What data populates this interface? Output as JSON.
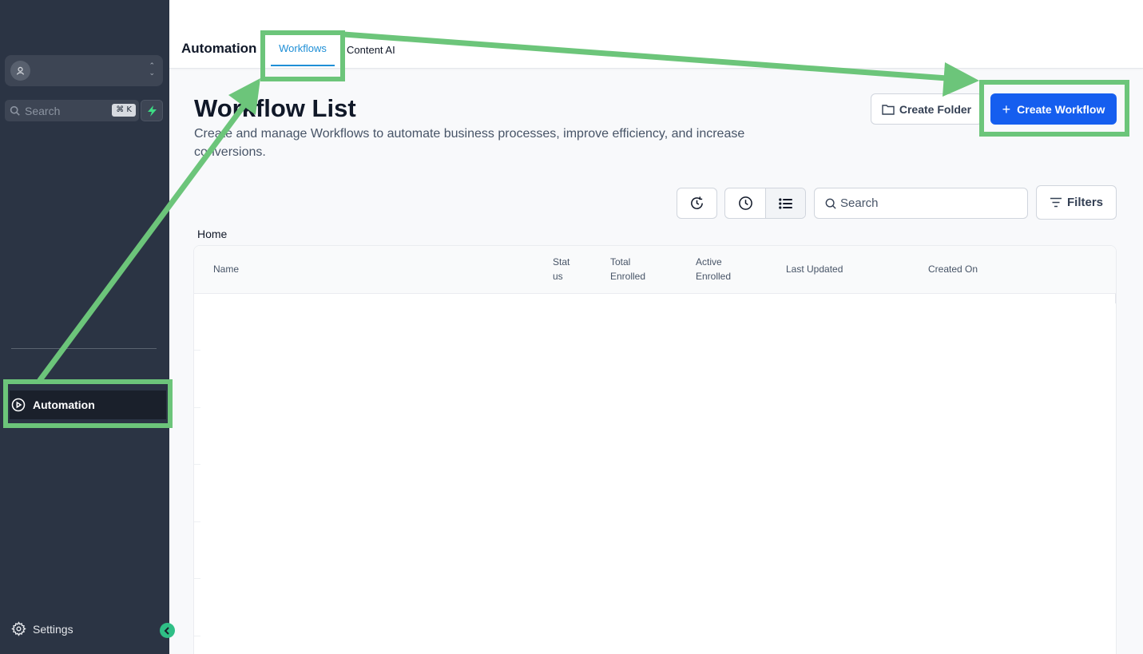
{
  "sidebar": {
    "search_placeholder": "Search",
    "search_shortcut": "⌘ K",
    "nav_automation": "Automation",
    "nav_settings": "Settings"
  },
  "topbar": {
    "module_title": "Automation",
    "tabs": [
      {
        "label": "Workflows",
        "active": true
      },
      {
        "label": "Content AI",
        "active": false
      }
    ]
  },
  "header": {
    "title": "Workflow List",
    "subtitle": "Create and manage Workflows to automate business processes, improve efficiency, and increase conversions.",
    "create_folder_label": "Create Folder",
    "create_workflow_label": "Create Workflow"
  },
  "toolbar": {
    "search_placeholder": "Search",
    "filters_label": "Filters"
  },
  "breadcrumb": "Home",
  "table": {
    "columns": [
      "Name",
      "Stat\nus",
      "Total\nEnrolled",
      "Active\nEnrolled",
      "Last Updated",
      "Created On"
    ]
  },
  "colors": {
    "sidebar_bg": "#2b3444",
    "primary": "#155eef",
    "tab_active": "#1f8fd6",
    "annotation": "#6cc57a"
  }
}
